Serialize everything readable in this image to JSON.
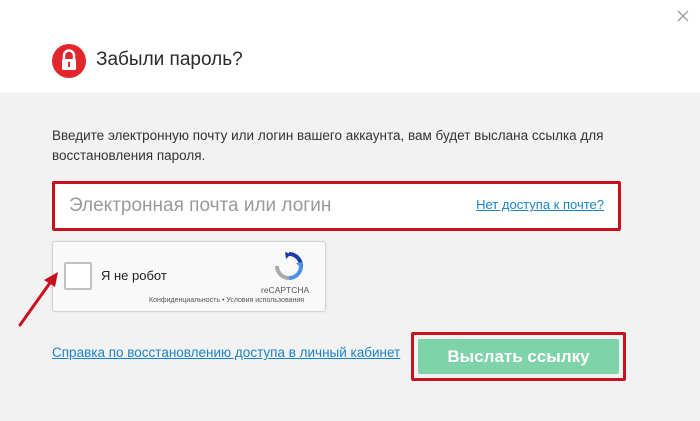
{
  "header": {
    "title": "Забыли пароль?",
    "lock_icon": "lock-icon",
    "close_icon": "close-icon"
  },
  "description": "Введите электронную почту или логин вашего аккаунта, вам будет выслана ссылка для восстановления пароля.",
  "login_field": {
    "value": "",
    "placeholder": "Электронная почта или логин",
    "no_access_link": "Нет доступа к почте?"
  },
  "captcha": {
    "label": "Я не робот",
    "brand": "reCAPTCHA",
    "terms": "Конфиденциальность • Условия использования",
    "checked": false
  },
  "help_link": "Справка по восстановлению доступа в личный кабинет",
  "submit_label": "Выслать ссылку",
  "colors": {
    "accent_red": "#e2272c",
    "highlight_red": "#c8111c",
    "link_blue": "#1a83c8",
    "submit_green": "#7fd3a8",
    "panel_gray": "#f2f2f2"
  }
}
